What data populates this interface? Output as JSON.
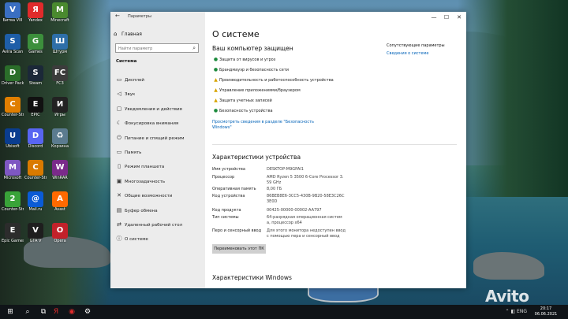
{
  "desktop": {
    "icons": [
      {
        "label": "Битва VIII",
        "glyph": "V",
        "color": "#3a6fc2"
      },
      {
        "label": "Avira Scan",
        "glyph": "S",
        "color": "#1e5ea8"
      },
      {
        "label": "Driver Pack",
        "glyph": "D",
        "color": "#2b6e2a"
      },
      {
        "label": "Counter-Str",
        "glyph": "C",
        "color": "#e07e00"
      },
      {
        "label": "Ubisoft",
        "glyph": "U",
        "color": "#0a3d8f"
      },
      {
        "label": "Microsoft",
        "glyph": "M",
        "color": "#7e57c2"
      },
      {
        "label": "Counter-Str",
        "glyph": "2",
        "color": "#39a339"
      },
      {
        "label": "Epic Games",
        "glyph": "E",
        "color": "#2c2c2c"
      },
      {
        "label": "Yandex",
        "glyph": "Я",
        "color": "#e02b2b"
      },
      {
        "label": "Games",
        "glyph": "G",
        "color": "#3c8f3c"
      },
      {
        "label": "Steam",
        "glyph": "S",
        "color": "#1b2838"
      },
      {
        "label": "EPIC",
        "glyph": "E",
        "color": "#111111"
      },
      {
        "label": "Discord",
        "glyph": "D",
        "color": "#5865f2"
      },
      {
        "label": "Counter-Str",
        "glyph": "C",
        "color": "#d97a00"
      },
      {
        "label": "Mail.ru",
        "glyph": "@",
        "color": "#0a5bd6"
      },
      {
        "label": "GTA V",
        "glyph": "V",
        "color": "#1e1e1e"
      },
      {
        "label": "Minecraft",
        "glyph": "M",
        "color": "#4a8a2f"
      },
      {
        "label": "Штурм",
        "glyph": "Ш",
        "color": "#2e6fa8"
      },
      {
        "label": "FC3",
        "glyph": "FC",
        "color": "#3c3c3c"
      },
      {
        "label": "Игры",
        "glyph": "И",
        "color": "#222222"
      },
      {
        "label": "Корзина",
        "glyph": "♻",
        "color": "#5b7b8f"
      },
      {
        "label": "WinRAR",
        "glyph": "W",
        "color": "#7a2a8a"
      },
      {
        "label": "Avast",
        "glyph": "A",
        "color": "#ff6a00"
      },
      {
        "label": "Opera",
        "glyph": "O",
        "color": "#c2212a"
      }
    ]
  },
  "window": {
    "title": "Параметры",
    "back": "←",
    "minimize": "—",
    "maximize": "☐",
    "close": "✕"
  },
  "sidebar": {
    "home": "Главная",
    "search_placeholder": "Найти параметр",
    "section": "Система",
    "items": [
      {
        "label": "Дисплей",
        "icon": "▭"
      },
      {
        "label": "Звук",
        "icon": "◁"
      },
      {
        "label": "Уведомления и действия",
        "icon": "▢"
      },
      {
        "label": "Фокусировка внимания",
        "icon": "☾"
      },
      {
        "label": "Питание и спящий режим",
        "icon": "⏻"
      },
      {
        "label": "Память",
        "icon": "▭"
      },
      {
        "label": "Режим планшета",
        "icon": "▯"
      },
      {
        "label": "Многозадачность",
        "icon": "▣"
      },
      {
        "label": "Общие возможности",
        "icon": "✕"
      },
      {
        "label": "Буфер обмена",
        "icon": "▤"
      },
      {
        "label": "Удаленный рабочий стол",
        "icon": "⇄"
      },
      {
        "label": "О системе",
        "icon": "ⓘ"
      }
    ]
  },
  "main": {
    "title": "О системе",
    "protection_heading": "Ваш компьютер защищен",
    "protection_items": [
      {
        "label": "Защита от вирусов и угроз",
        "status": "ok"
      },
      {
        "label": "Брандмауэр и безопасность сети",
        "status": "ok"
      },
      {
        "label": "Производительность и работоспособность устройства",
        "status": "warn"
      },
      {
        "label": "Управление приложениями/браузером",
        "status": "warn"
      },
      {
        "label": "Защита учетных записей",
        "status": "warn"
      },
      {
        "label": "Безопасность устройства",
        "status": "ok"
      }
    ],
    "security_link": "Просмотреть сведения в разделе \"Безопасность Windows\"",
    "device_specs_heading": "Характеристики устройства",
    "specs": [
      {
        "key": "Имя устройства",
        "value": "DESKTOP-M9GPAI1"
      },
      {
        "key": "Процессор",
        "value": "AMD Ryzen 5 3500 6-Core Processor 3.59 GHz"
      },
      {
        "key": "Оперативная память",
        "value": "8,00 ГБ"
      },
      {
        "key": "Код устройства",
        "value": "86BEB8E6-3CC5-430B-9B20-58E3C26C3E0D"
      },
      {
        "key": "Код продукта",
        "value": "00425-00000-00002-AA797"
      },
      {
        "key": "Тип системы",
        "value": "64-разрядная операционная система, процессор x64"
      },
      {
        "key": "Перо и сенсорный ввод",
        "value": "Для этого монитора недоступен ввод с помощью пера и сенсорный ввод"
      }
    ],
    "copy_button": "Переименовать этот ПК",
    "windows_specs_heading": "Характеристики Windows",
    "related_heading": "Сопутствующие параметры",
    "related_link": "Сведения о системе"
  },
  "taskbar": {
    "start": "⊞",
    "search": "⌕",
    "taskview": "⧉",
    "apps": [
      {
        "glyph": "Я",
        "color": "#e02b2b"
      },
      {
        "glyph": "◉",
        "color": "#e02b2b"
      },
      {
        "glyph": "⚙",
        "color": "#ffffff"
      }
    ],
    "tray": "⌃  ◧  ENG",
    "time": "20:17",
    "date": "06.06.2021"
  },
  "watermark": "Avito"
}
